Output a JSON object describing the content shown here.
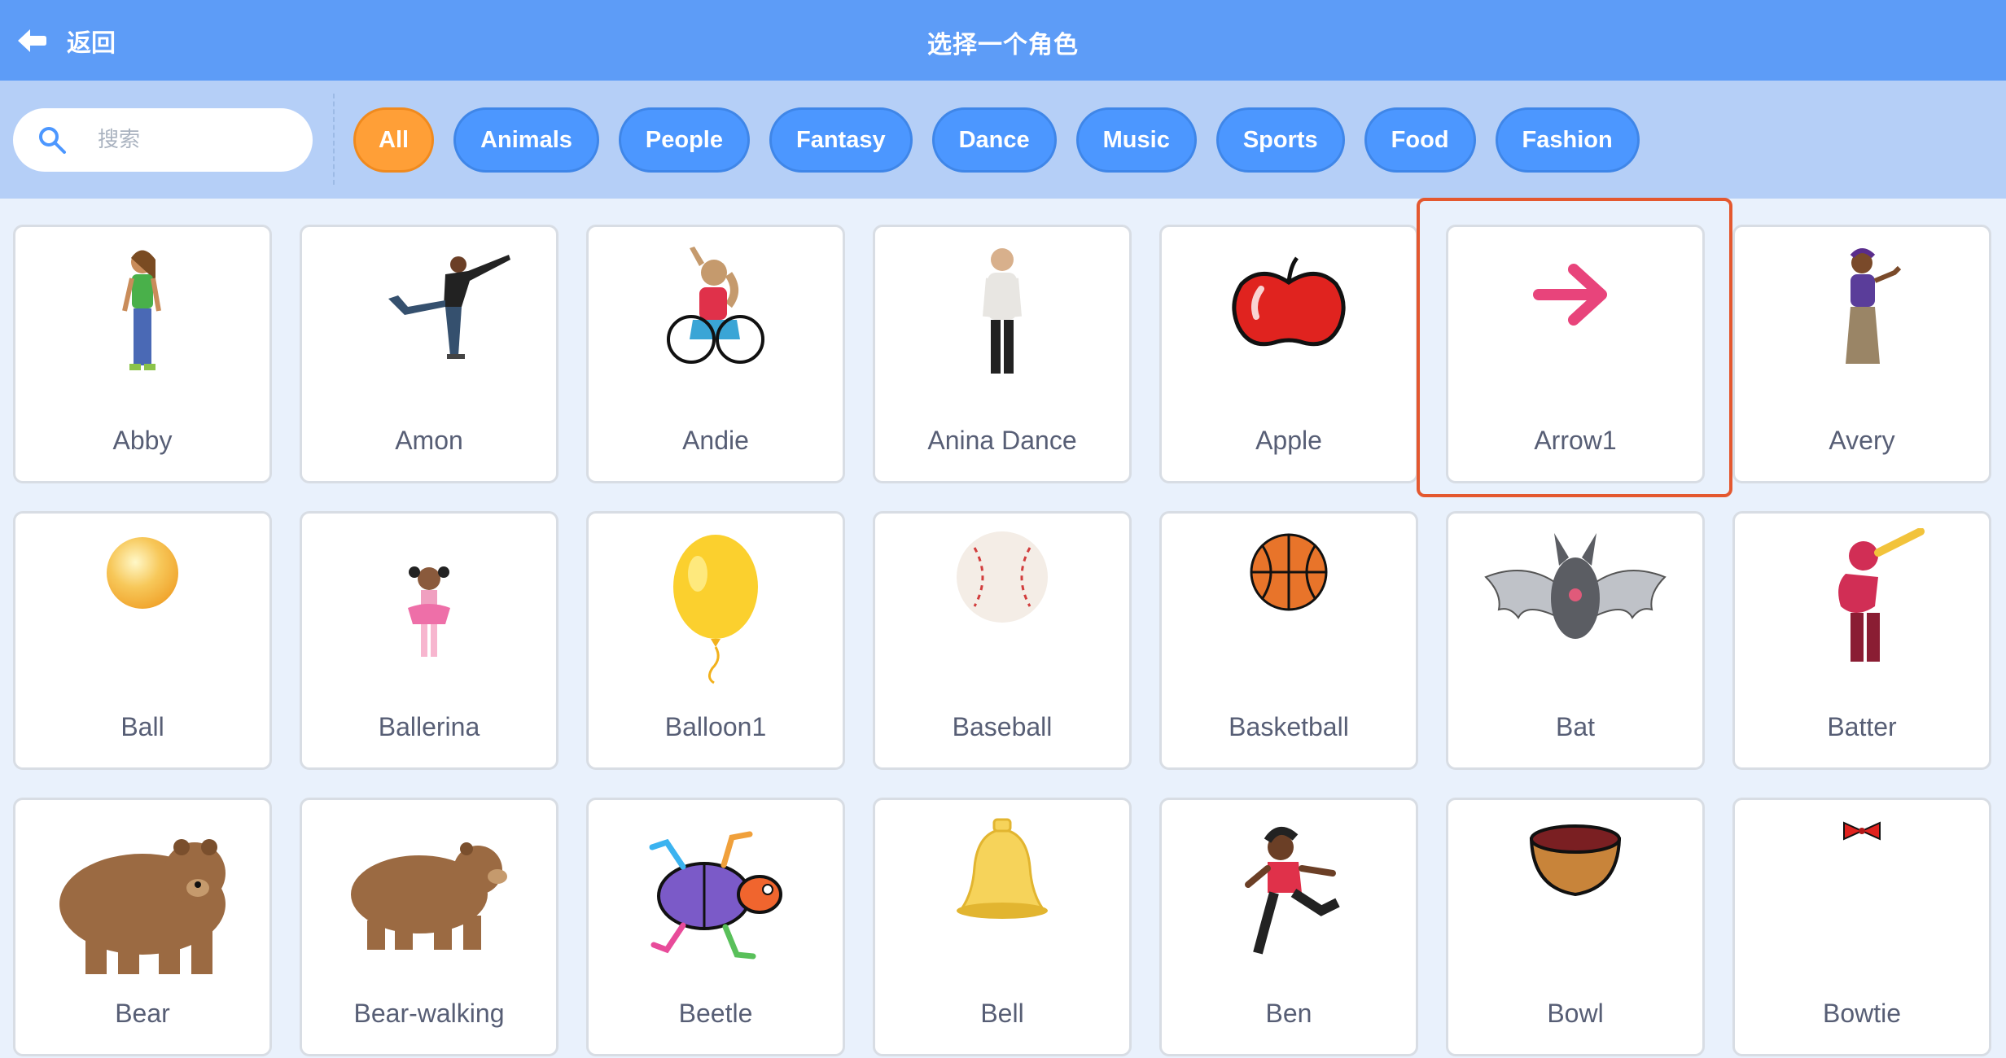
{
  "header": {
    "back_label": "返回",
    "title": "选择一个角色"
  },
  "search": {
    "placeholder": "搜索"
  },
  "tags": [
    "All",
    "Animals",
    "People",
    "Fantasy",
    "Dance",
    "Music",
    "Sports",
    "Food",
    "Fashion"
  ],
  "active_tag": "All",
  "colors": {
    "header": "#5d9cf7",
    "filterbar": "#b5cff7",
    "tag": "#4c97ff",
    "tag_active": "#ff9f37",
    "highlight": "#e4582f"
  },
  "sprites": [
    {
      "name": "Abby",
      "icon": "girl-figure"
    },
    {
      "name": "Amon",
      "icon": "dancer-figure"
    },
    {
      "name": "Andie",
      "icon": "wheelchair-athlete"
    },
    {
      "name": "Anina Dance",
      "icon": "woman-standing"
    },
    {
      "name": "Apple",
      "icon": "apple"
    },
    {
      "name": "Arrow1",
      "icon": "arrow"
    },
    {
      "name": "Avery",
      "icon": "girl-waving"
    },
    {
      "name": "Ball",
      "icon": "ball"
    },
    {
      "name": "Ballerina",
      "icon": "ballerina"
    },
    {
      "name": "Balloon1",
      "icon": "balloon"
    },
    {
      "name": "Baseball",
      "icon": "baseball"
    },
    {
      "name": "Basketball",
      "icon": "basketball"
    },
    {
      "name": "Bat",
      "icon": "bat"
    },
    {
      "name": "Batter",
      "icon": "batter"
    },
    {
      "name": "Bear",
      "icon": "bear"
    },
    {
      "name": "Bear-walking",
      "icon": "bear-walking"
    },
    {
      "name": "Beetle",
      "icon": "beetle"
    },
    {
      "name": "Bell",
      "icon": "bell"
    },
    {
      "name": "Ben",
      "icon": "boy-running"
    },
    {
      "name": "Bowl",
      "icon": "bowl"
    },
    {
      "name": "Bowtie",
      "icon": "bowtie"
    }
  ],
  "highlighted_sprite": "Arrow1"
}
